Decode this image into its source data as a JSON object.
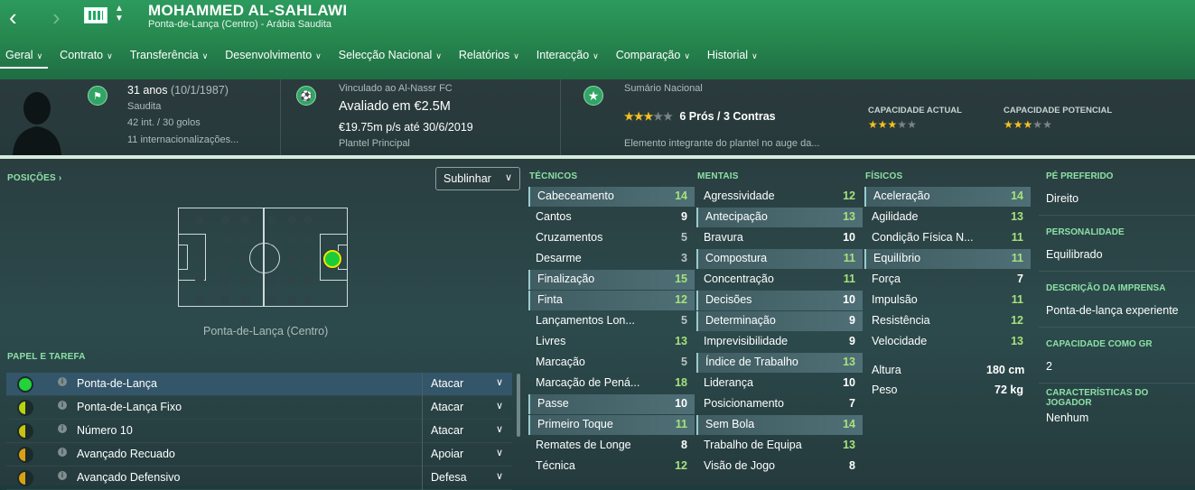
{
  "header": {
    "player_name": "MOHAMMED AL-SAHLAWI",
    "subtitle": "Ponta-de-Lança (Centro) - Arábia Saudita",
    "nav_back": "‹",
    "nav_forward": "›",
    "tabs": [
      {
        "label": "Geral"
      },
      {
        "label": "Contrato"
      },
      {
        "label": "Transferência"
      },
      {
        "label": "Desenvolvimento"
      },
      {
        "label": "Selecção Nacional"
      },
      {
        "label": "Relatórios"
      },
      {
        "label": "Interacção"
      },
      {
        "label": "Comparação"
      },
      {
        "label": "Historial"
      }
    ]
  },
  "summary": {
    "age": "31 anos",
    "dob": "(10/1/1987)",
    "nationality": "Saudita",
    "caps": "42 int. / 30 golos",
    "intl_caps": "11 internacionalizações...",
    "club_line": "Vinculado ao Al-Nassr FC",
    "value": "Avaliado em €2.5M",
    "wage": "€19.75m p/s até 30/6/2019",
    "squad": "Plantel Principal",
    "national_title": "Sumário Nacional",
    "pros_cons": "6 Prós / 3 Contras",
    "national_desc": "Elemento integrante do plantel no auge da...",
    "current_ability_label": "CAPACIDADE ACTUAL",
    "potential_ability_label": "CAPACIDADE POTENCIAL",
    "national_stars": 3,
    "current_stars": 3,
    "potential_stars": 3,
    "stars_max": 5
  },
  "positions": {
    "title": "POSIÇÕES",
    "highlight_select": "Sublinhar",
    "position_label": "Ponta-de-Lança (Centro)"
  },
  "roles": {
    "title": "PAPEL E TAREFA",
    "items": [
      {
        "name": "Ponta-de-Lança",
        "duty": "Atacar",
        "suitability": "natural"
      },
      {
        "name": "Ponta-de-Lança Fixo",
        "duty": "Atacar",
        "suitability": "accomplished"
      },
      {
        "name": "Número 10",
        "duty": "Atacar",
        "suitability": "competent"
      },
      {
        "name": "Avançado Recuado",
        "duty": "Apoiar",
        "suitability": "unconvincing"
      },
      {
        "name": "Avançado Defensivo",
        "duty": "Defesa",
        "suitability": "unconvincing"
      }
    ]
  },
  "attributes": {
    "technical_title": "TÉCNICOS",
    "mental_title": "MENTAIS",
    "physical_title": "FÍSICOS",
    "technical": [
      {
        "name": "Cabeceamento",
        "value": 14,
        "hl": true
      },
      {
        "name": "Cantos",
        "value": 9,
        "hl": false
      },
      {
        "name": "Cruzamentos",
        "value": 5,
        "hl": false
      },
      {
        "name": "Desarme",
        "value": 3,
        "hl": false
      },
      {
        "name": "Finalização",
        "value": 15,
        "hl": true
      },
      {
        "name": "Finta",
        "value": 12,
        "hl": true
      },
      {
        "name": "Lançamentos Lon...",
        "value": 5,
        "hl": false
      },
      {
        "name": "Livres",
        "value": 13,
        "hl": false
      },
      {
        "name": "Marcação",
        "value": 5,
        "hl": false
      },
      {
        "name": "Marcação de Pená...",
        "value": 18,
        "hl": false
      },
      {
        "name": "Passe",
        "value": 10,
        "hl": true
      },
      {
        "name": "Primeiro Toque",
        "value": 11,
        "hl": true
      },
      {
        "name": "Remates de Longe",
        "value": 8,
        "hl": false
      },
      {
        "name": "Técnica",
        "value": 12,
        "hl": false
      }
    ],
    "mental": [
      {
        "name": "Agressividade",
        "value": 12,
        "hl": false
      },
      {
        "name": "Antecipação",
        "value": 13,
        "hl": true
      },
      {
        "name": "Bravura",
        "value": 10,
        "hl": false
      },
      {
        "name": "Compostura",
        "value": 11,
        "hl": true
      },
      {
        "name": "Concentração",
        "value": 11,
        "hl": false
      },
      {
        "name": "Decisões",
        "value": 10,
        "hl": true
      },
      {
        "name": "Determinação",
        "value": 9,
        "hl": true
      },
      {
        "name": "Imprevisibilidade",
        "value": 9,
        "hl": false
      },
      {
        "name": "Índice de Trabalho",
        "value": 13,
        "hl": true
      },
      {
        "name": "Liderança",
        "value": 10,
        "hl": false
      },
      {
        "name": "Posicionamento",
        "value": 7,
        "hl": false
      },
      {
        "name": "Sem Bola",
        "value": 14,
        "hl": true
      },
      {
        "name": "Trabalho de Equipa",
        "value": 13,
        "hl": false
      },
      {
        "name": "Visão de Jogo",
        "value": 8,
        "hl": false
      }
    ],
    "physical": [
      {
        "name": "Aceleração",
        "value": 14,
        "hl": true
      },
      {
        "name": "Agilidade",
        "value": 13,
        "hl": false
      },
      {
        "name": "Condição Física N...",
        "value": 11,
        "hl": false
      },
      {
        "name": "Equilíbrio",
        "value": 11,
        "hl": true
      },
      {
        "name": "Força",
        "value": 7,
        "hl": false
      },
      {
        "name": "Impulsão",
        "value": 11,
        "hl": false
      },
      {
        "name": "Resistência",
        "value": 12,
        "hl": false
      },
      {
        "name": "Velocidade",
        "value": 13,
        "hl": false
      }
    ],
    "height_label": "Altura",
    "height_value": "180 cm",
    "weight_label": "Peso",
    "weight_value": "72 kg"
  },
  "right_panel": {
    "preferred_foot_label": "PÉ PREFERIDO",
    "preferred_foot": "Direito",
    "personality_label": "PERSONALIDADE",
    "personality": "Equilibrado",
    "press_label": "DESCRIÇÃO DA IMPRENSA",
    "press": "Ponta-de-lança experiente",
    "gk_label": "CAPACIDADE COMO GR",
    "gk": "2",
    "traits_label": "CARACTERÍSTICAS DO JOGADOR",
    "traits": "Nenhum"
  },
  "colors": {
    "header_green": "#27894f",
    "accent_green": "#8ce0a6",
    "value_green": "#a6e27a",
    "star_gold": "#f4c021"
  }
}
